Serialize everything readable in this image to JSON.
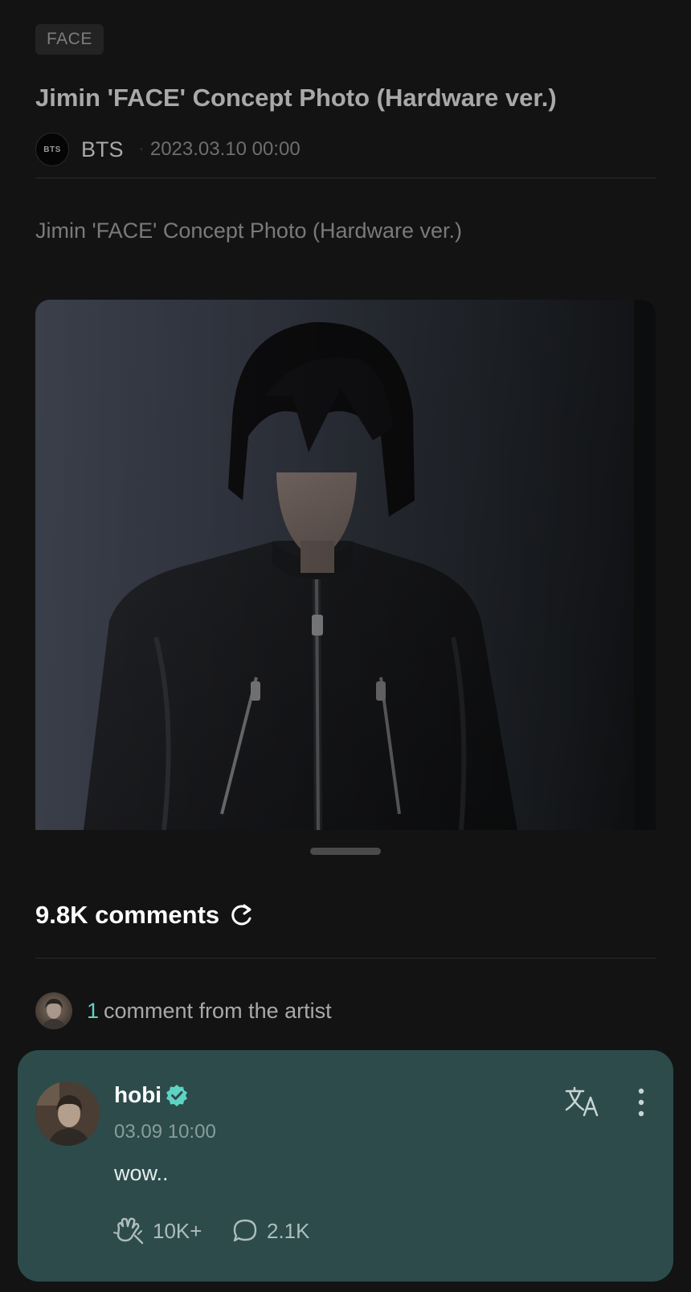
{
  "post": {
    "tag": "FACE",
    "title": "Jimin 'FACE' Concept Photo (Hardware ver.)",
    "author": "BTS",
    "author_logo_text": "BTS",
    "separator": "·",
    "date": "2023.03.10 00:00",
    "body": "Jimin 'FACE' Concept Photo (Hardware ver.)"
  },
  "comments": {
    "count_label": "9.8K comments",
    "artist_count": "1",
    "artist_label": "comment from the artist",
    "items": [
      {
        "username": "hobi",
        "verified": true,
        "date": "03.09 10:00",
        "text": "wow..",
        "likes": "10K+",
        "replies": "2.1K"
      }
    ]
  },
  "colors": {
    "background": "#131313",
    "accent": "#5fd3c3",
    "artist_comment_card": "#2d4b4b"
  },
  "icons": {
    "refresh": "refresh-icon",
    "verified": "verified-badge-icon",
    "translate": "translate-icon",
    "more": "more-vertical-icon",
    "like": "cheer-hand-icon",
    "reply": "speech-bubble-icon"
  }
}
